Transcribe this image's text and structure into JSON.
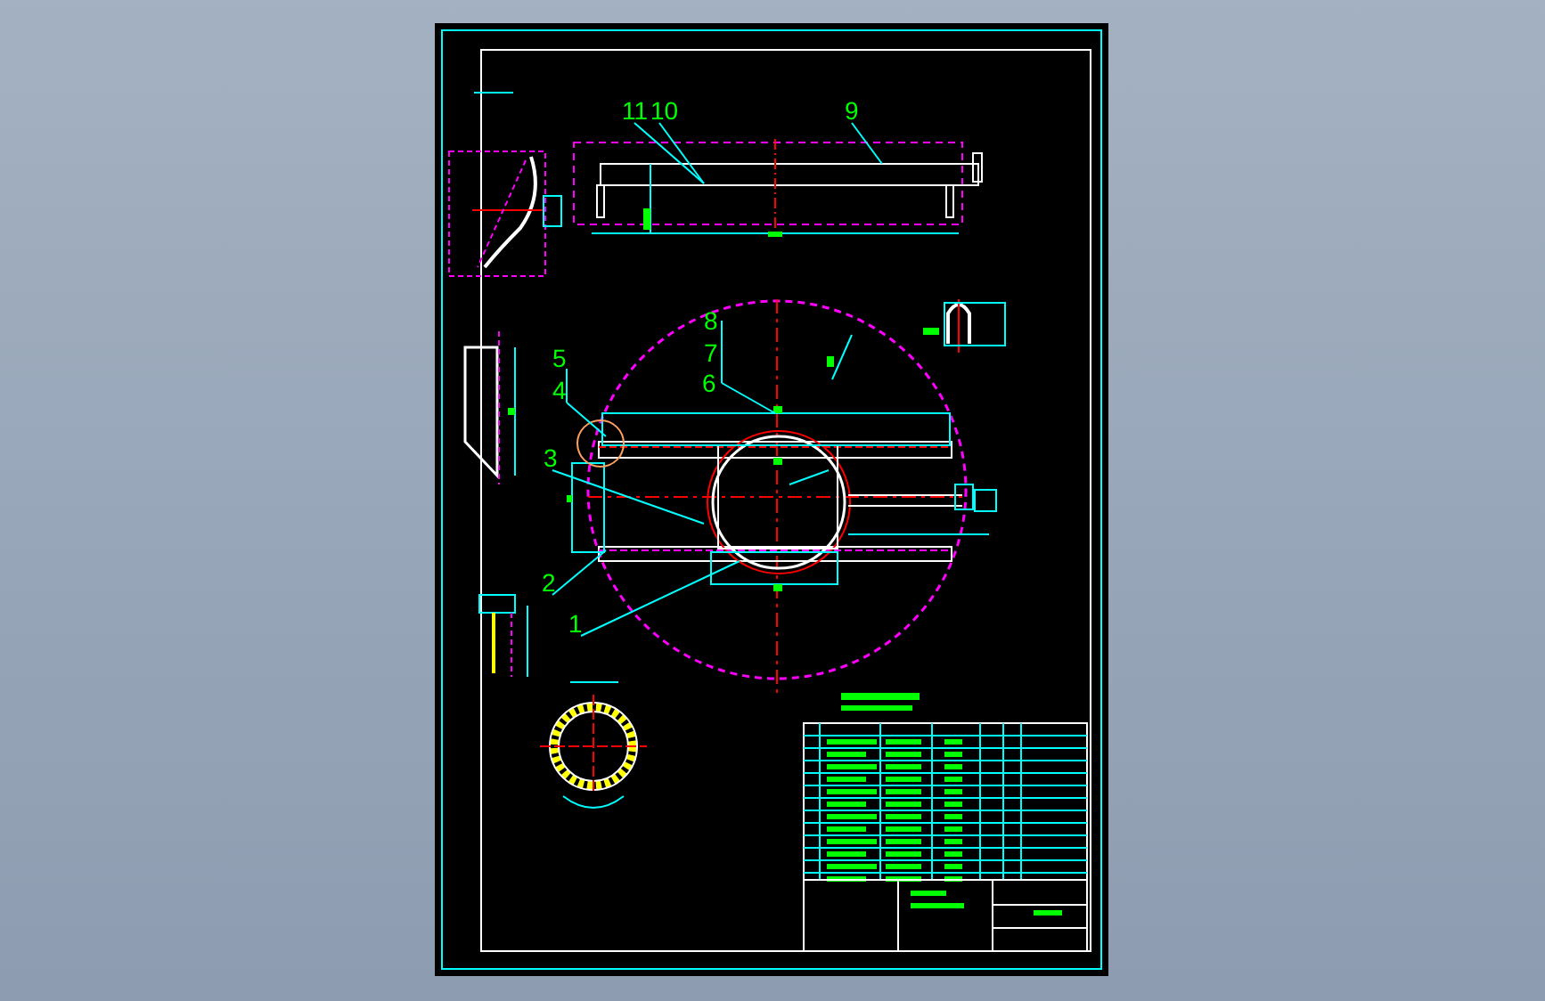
{
  "drawing": {
    "callouts": [
      {
        "label": "11"
      },
      {
        "label": "10"
      },
      {
        "label": "9"
      },
      {
        "label": "8"
      },
      {
        "label": "7"
      },
      {
        "label": "6"
      },
      {
        "label": "5"
      },
      {
        "label": "4"
      },
      {
        "label": "3"
      },
      {
        "label": "2"
      },
      {
        "label": "1"
      }
    ]
  }
}
